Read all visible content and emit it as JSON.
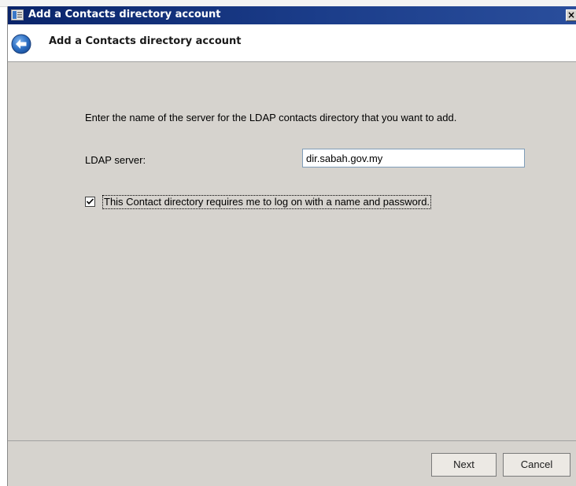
{
  "window": {
    "title": "Add a Contacts directory account"
  },
  "header": {
    "title": "Add a Contacts directory account"
  },
  "content": {
    "instruction": "Enter the name of the server for the LDAP contacts directory that you want to add.",
    "ldap_label": "LDAP server:",
    "ldap_value": "dir.sabah.gov.my",
    "checkbox_label": "This Contact directory requires me to log on with a name and password.",
    "checkbox_checked": true
  },
  "footer": {
    "next_label": "Next",
    "cancel_label": "Cancel"
  },
  "icons": {
    "app": "contacts-app-icon",
    "back": "back-arrow-icon",
    "close": "close-icon",
    "check": "checkmark-icon"
  },
  "colors": {
    "titlebar": "#0a246a",
    "window_bg": "#d6d3ce",
    "back_button": "#2d6fc3"
  }
}
